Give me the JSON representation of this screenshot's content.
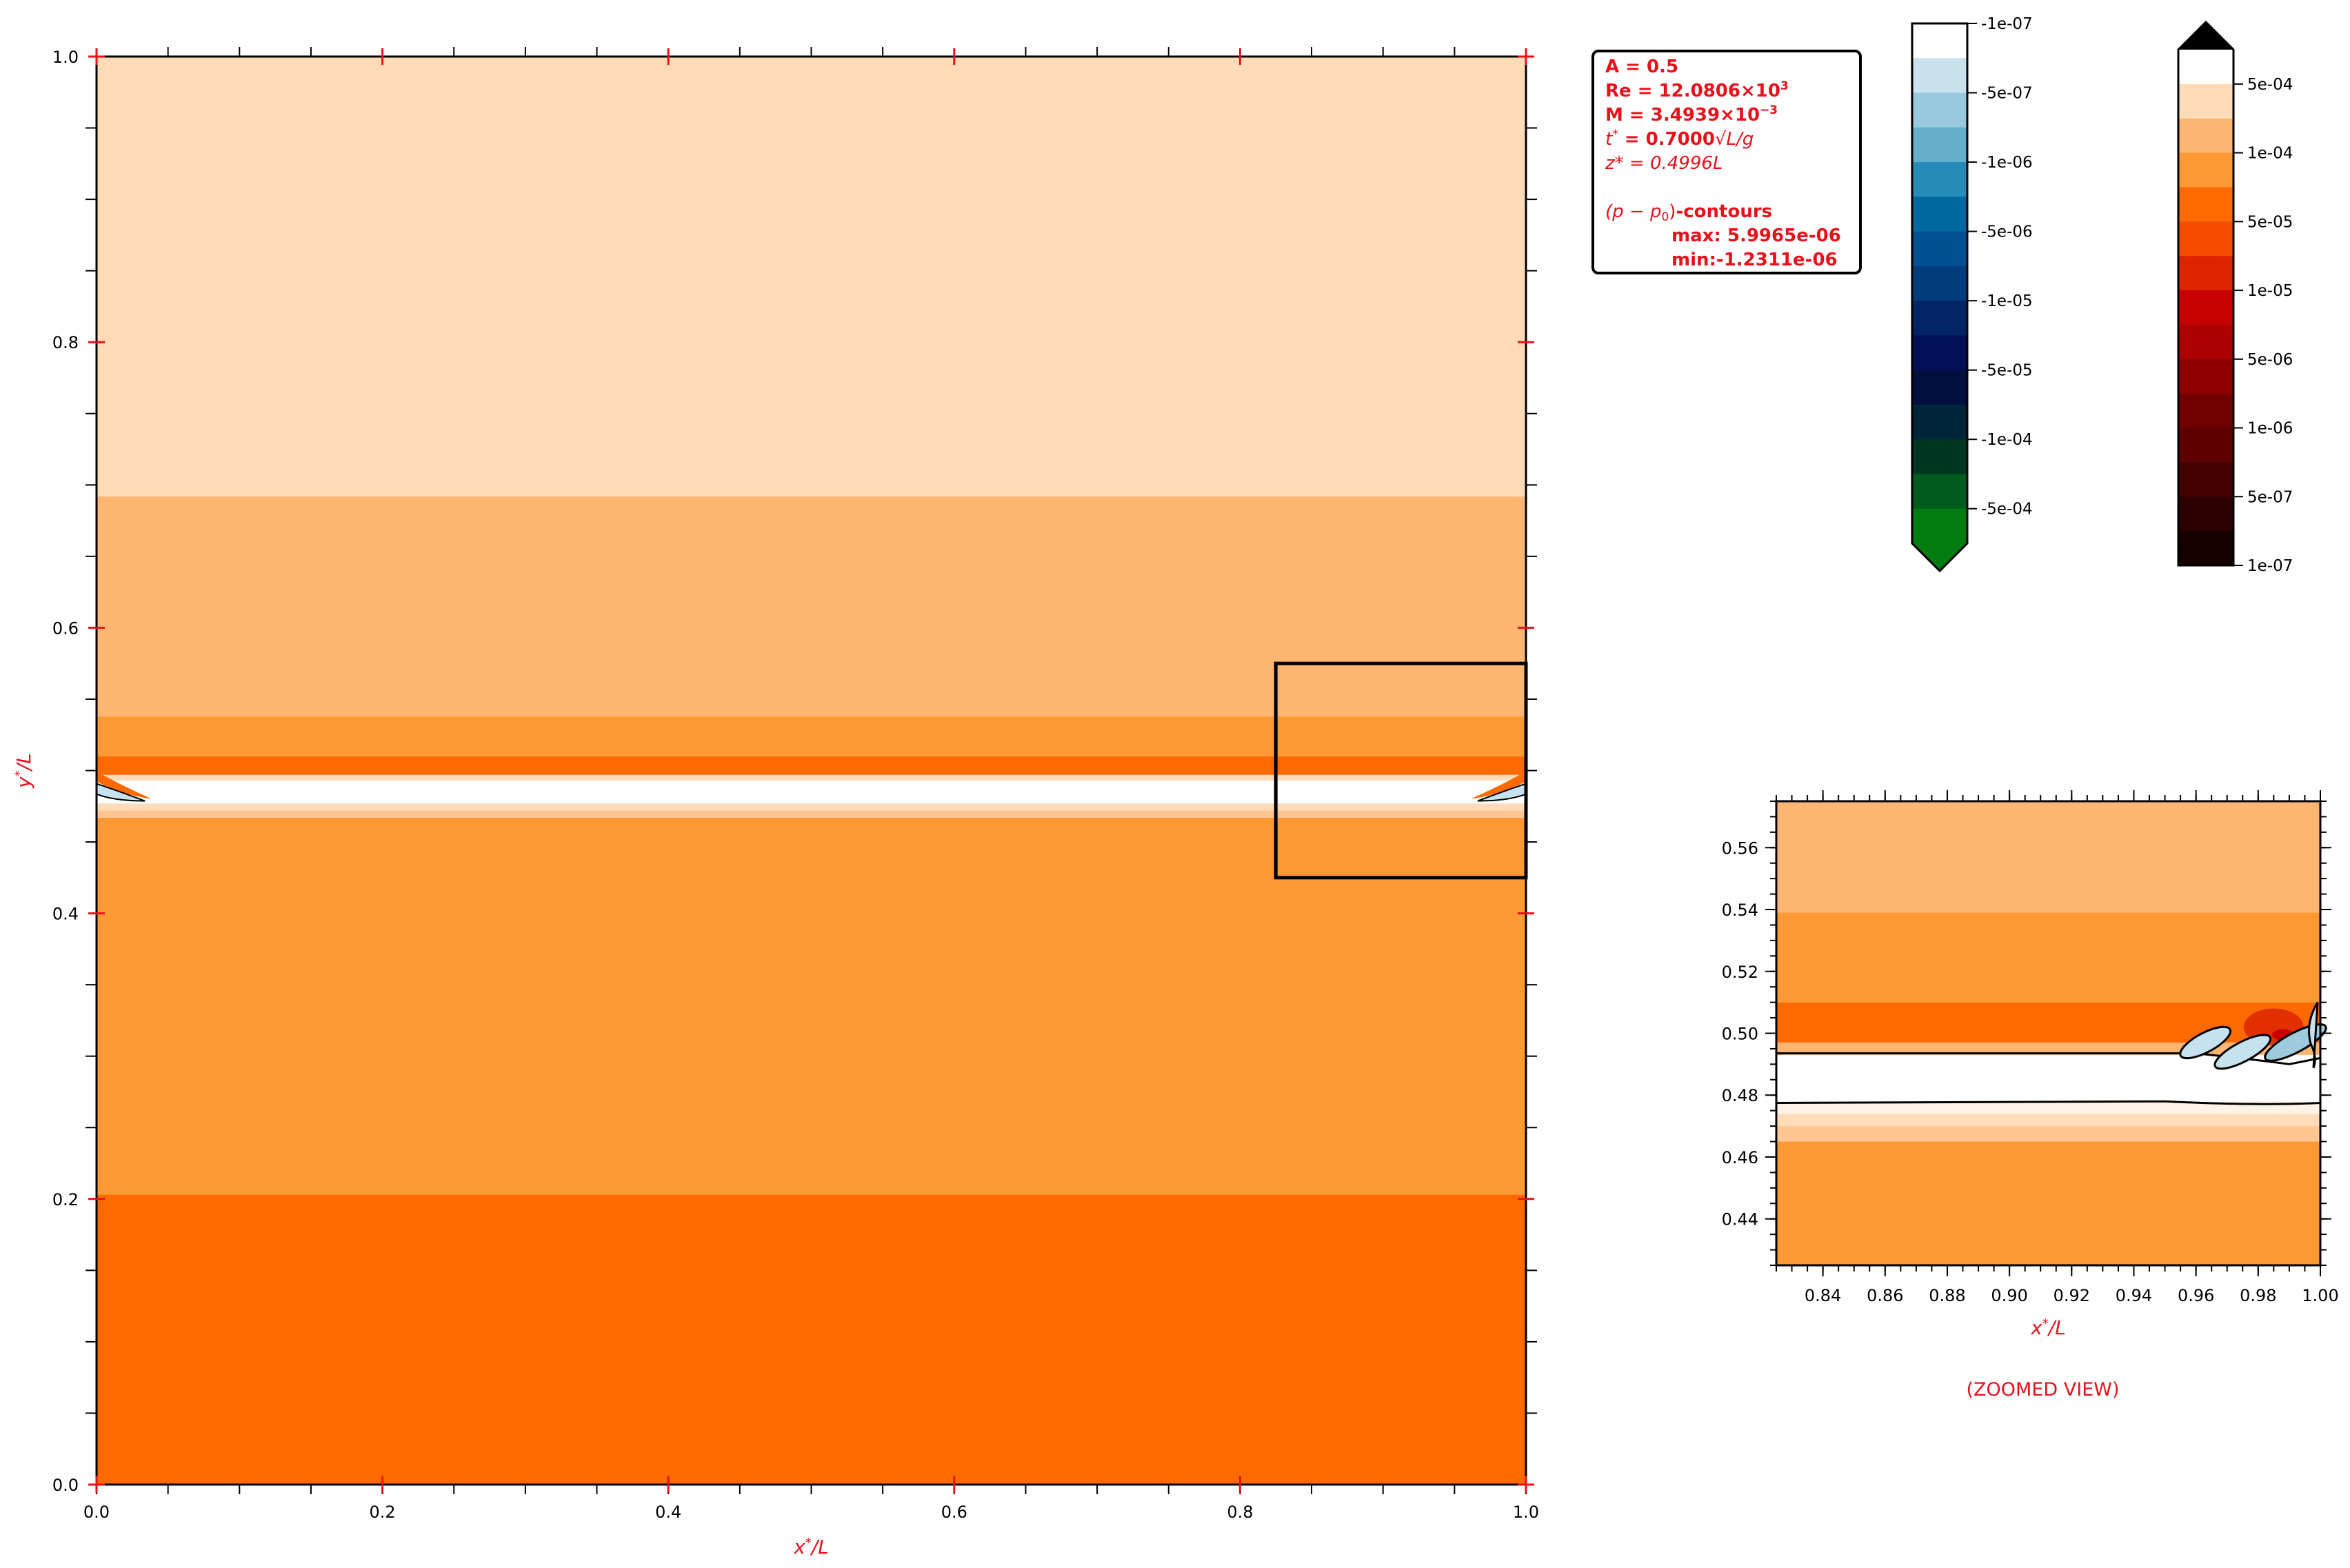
{
  "info_box": {
    "A_line": "A  = 0.5",
    "Re_line": "Re = 12.0806×10",
    "Re_exp": "3",
    "M_line": "M  =  3.4939×10",
    "M_exp": "−3",
    "t_label": "t",
    "t_star": "*",
    "t_eq": " =  0.7000",
    "t_unit": "√L/g",
    "z_label": "z* = 0.4996",
    "z_unit": "L",
    "contour_label_pre": "(p − p",
    "contour_label_sub": "0",
    "contour_label_post": ")",
    "contour_label_bold": "-contours",
    "max_line": "max: 5.9965e-06",
    "min_line": "min:-1.2311e-06"
  },
  "chart_data": [
    {
      "type": "heatmap",
      "name": "main",
      "xlabel": "x*/L",
      "ylabel": "y*/L",
      "xlim": [
        0.0,
        1.0
      ],
      "ylim": [
        0.0,
        1.0
      ],
      "xticks": [
        "0.0",
        "0.2",
        "0.4",
        "0.6",
        "0.8",
        "1.0"
      ],
      "yticks": [
        "0.0",
        "0.2",
        "0.4",
        "0.6",
        "0.8",
        "1.0"
      ],
      "bands": [
        {
          "y0": 0.0,
          "y1": 0.203,
          "color": "#ff6a00"
        },
        {
          "y0": 0.203,
          "y1": 0.467,
          "color": "#fe9934"
        },
        {
          "y0": 0.467,
          "y1": 0.472,
          "color": "#ffc692"
        },
        {
          "y0": 0.472,
          "y1": 0.477,
          "color": "#ffdcb7"
        },
        {
          "y0": 0.477,
          "y1": 0.493,
          "color": "#ffffff"
        },
        {
          "y0": 0.493,
          "y1": 0.497,
          "color": "#ffdcb7"
        },
        {
          "y0": 0.497,
          "y1": 0.51,
          "color": "#ff6a00"
        },
        {
          "y0": 0.51,
          "y1": 0.538,
          "color": "#fe9934"
        },
        {
          "y0": 0.538,
          "y1": 0.692,
          "color": "#ffb673"
        },
        {
          "y0": 0.692,
          "y1": 1.0,
          "color": "#ffdbb6"
        }
      ],
      "zoom_box": {
        "x0": 0.825,
        "x1": 1.0,
        "y0": 0.425,
        "y1": 0.575
      }
    },
    {
      "type": "heatmap",
      "name": "zoom",
      "xlabel": "x*/L",
      "caption": "(ZOOMED VIEW)",
      "xlim": [
        0.825,
        1.0
      ],
      "ylim": [
        0.425,
        0.575
      ],
      "xticks": [
        "0.84",
        "0.86",
        "0.88",
        "0.90",
        "0.92",
        "0.94",
        "0.96",
        "0.98",
        "1.00"
      ],
      "yticks": [
        "0.44",
        "0.46",
        "0.48",
        "0.50",
        "0.52",
        "0.54",
        "0.56"
      ],
      "bands": [
        {
          "y0": 0.425,
          "y1": 0.465,
          "color": "#fe9934"
        },
        {
          "y0": 0.465,
          "y1": 0.47,
          "color": "#ffc692"
        },
        {
          "y0": 0.47,
          "y1": 0.474,
          "color": "#ffdcb7"
        },
        {
          "y0": 0.474,
          "y1": 0.478,
          "color": "#fff3e8"
        },
        {
          "y0": 0.478,
          "y1": 0.493,
          "color": "#ffffff"
        },
        {
          "y0": 0.493,
          "y1": 0.497,
          "color": "#ffb673"
        },
        {
          "y0": 0.497,
          "y1": 0.51,
          "color": "#ff6a00"
        },
        {
          "y0": 0.51,
          "y1": 0.539,
          "color": "#fe9934"
        },
        {
          "y0": 0.539,
          "y1": 0.575,
          "color": "#ffb673"
        }
      ],
      "lobes": [
        {
          "x": 0.963,
          "y": 0.497,
          "len": 0.018,
          "color": "#c6e2ef"
        },
        {
          "x": 0.975,
          "y": 0.494,
          "len": 0.02,
          "color": "#c6e2ef"
        },
        {
          "x": 0.992,
          "y": 0.497,
          "len": 0.022,
          "color": "#9ccbdd"
        }
      ]
    },
    {
      "type": "colorbar",
      "name": "negative",
      "colors": [
        "#ffffff",
        "#c8e1ed",
        "#98c9dc",
        "#64afcc",
        "#258cb9",
        "#00689f",
        "#005094",
        "#003d7c",
        "#002466",
        "#000f57",
        "#000f3e",
        "#002539",
        "#003723",
        "#005c1e",
        "#007d0e"
      ],
      "labels": [
        "-1e-07",
        "-5e-07",
        "-1e-06",
        "-5e-06",
        "-1e-05",
        "-5e-05",
        "-1e-04",
        "-5e-04"
      ],
      "extend": "min",
      "extend_color": "#007d0e"
    },
    {
      "type": "colorbar",
      "name": "positive",
      "colors": [
        "#ffffff",
        "#ffdcb7",
        "#ffb574",
        "#fe9934",
        "#ff6a00",
        "#f54c00",
        "#dc2500",
        "#c80000",
        "#ad0000",
        "#8f0000",
        "#730000",
        "#5c0000",
        "#440000",
        "#2d0000",
        "#170000"
      ],
      "labels": [
        "1e-07",
        "5e-07",
        "1e-06",
        "5e-06",
        "1e-05",
        "5e-05",
        "1e-04",
        "5e-04"
      ],
      "extend": "max",
      "extend_color": "#000000"
    }
  ]
}
